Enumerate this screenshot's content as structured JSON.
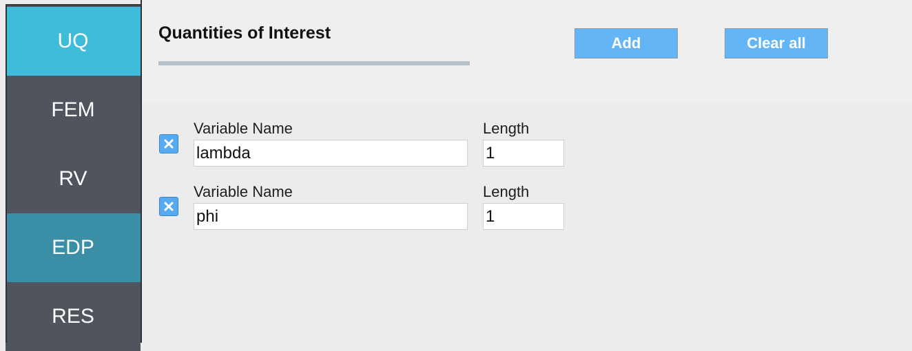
{
  "sidebar": {
    "items": [
      {
        "label": "UQ",
        "state": "active-light"
      },
      {
        "label": "FEM",
        "state": "normal"
      },
      {
        "label": "RV",
        "state": "normal"
      },
      {
        "label": "EDP",
        "state": "selected"
      },
      {
        "label": "RES",
        "state": "normal"
      }
    ]
  },
  "header": {
    "title": "Quantities of Interest",
    "add_label": "Add",
    "clear_label": "Clear all"
  },
  "qoi": {
    "rows": [
      {
        "name_label": "Variable Name",
        "name_value": "lambda",
        "length_label": "Length",
        "length_value": "1"
      },
      {
        "name_label": "Variable Name",
        "name_value": "phi",
        "length_label": "Length",
        "length_value": "1"
      }
    ]
  },
  "icons": {
    "remove": "close-icon"
  },
  "colors": {
    "sidebar_bg": "#50545c",
    "uq_tab": "#40bcdb",
    "edp_tab": "#3a8ea6",
    "button_bg": "#64b5f6"
  }
}
